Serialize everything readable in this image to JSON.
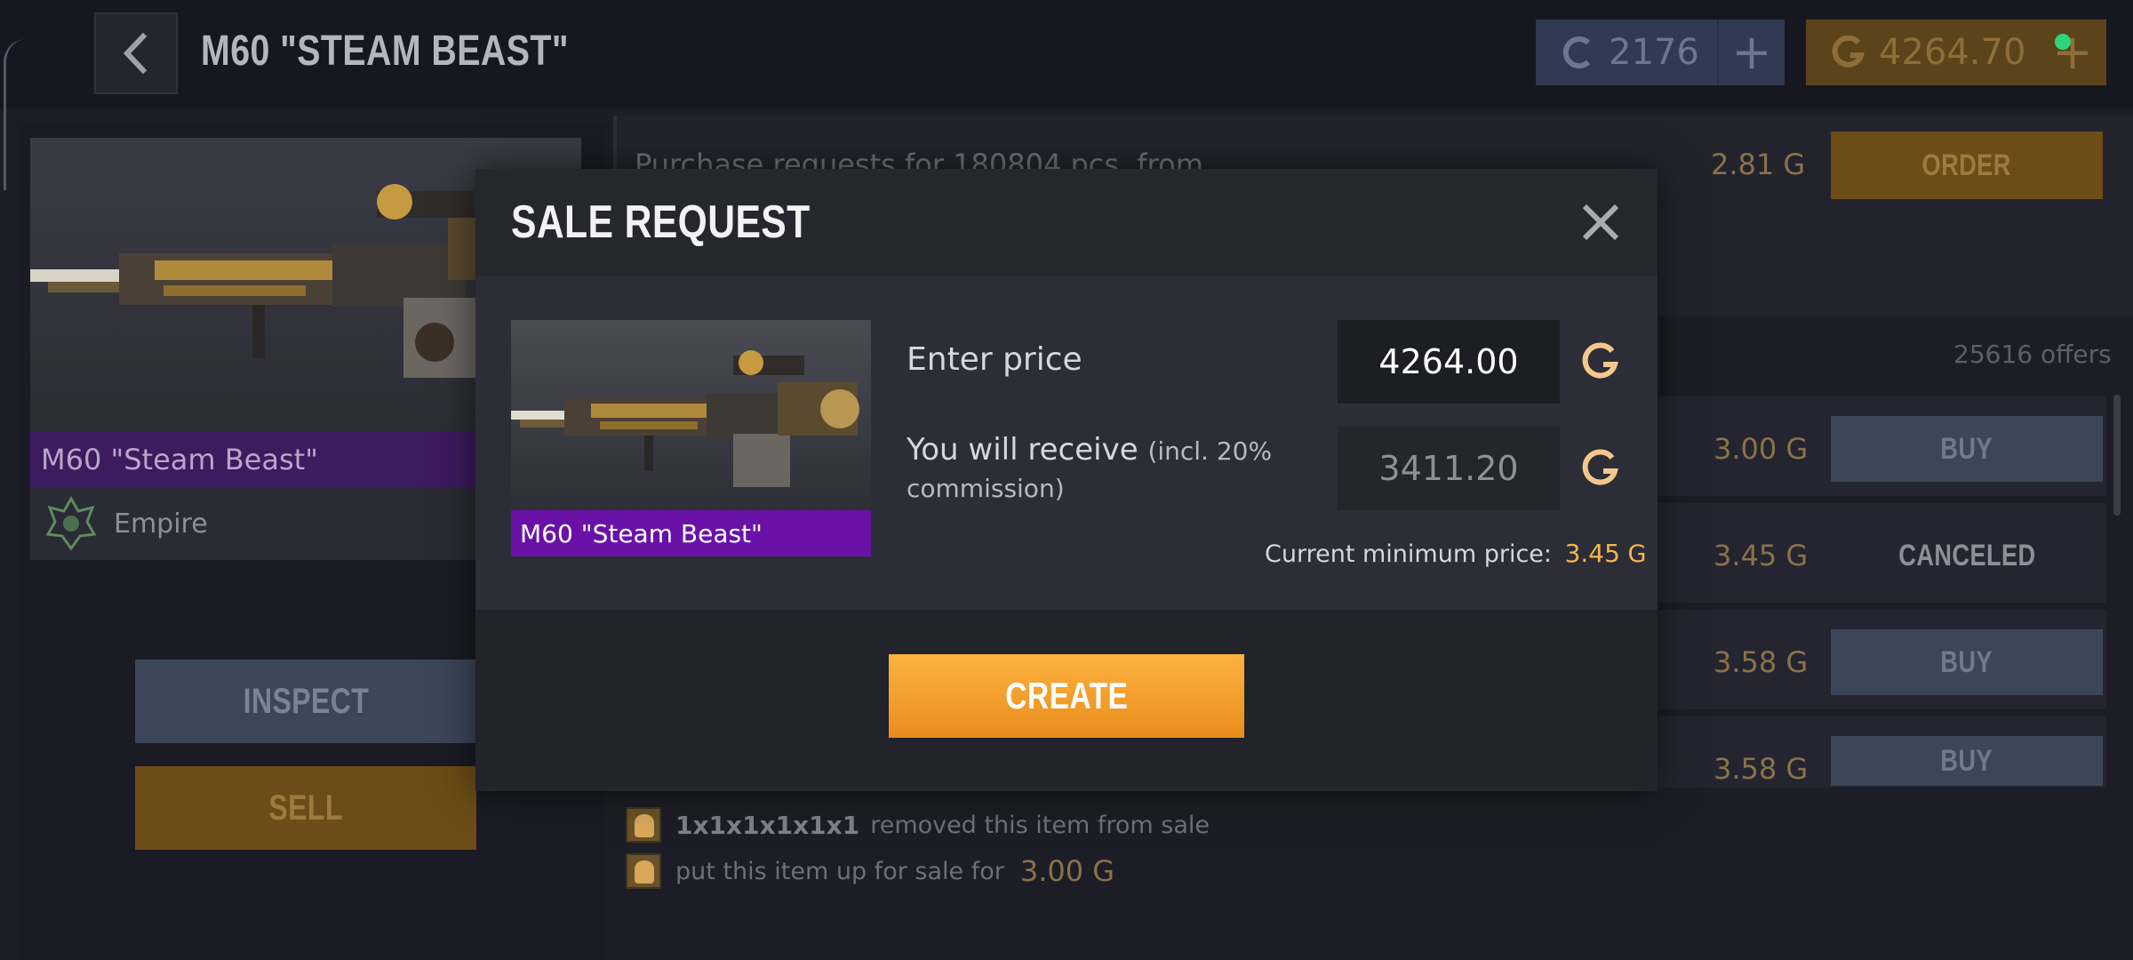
{
  "header": {
    "title": "M60 \"STEAM BEAST\"",
    "silver_balance": "2176",
    "gold_balance": "4264.70",
    "plus_symbol": "+"
  },
  "left": {
    "item_name": "M60 \"Steam Beast\"",
    "faction": "Empire",
    "inspect_label": "INSPECT",
    "sell_label": "SELL"
  },
  "market": {
    "purchase_text": "Purchase requests for 180804 pcs. from",
    "order_price": "2.81",
    "order_label": "ORDER",
    "offers_count": "25616 offers",
    "offers": [
      {
        "price": "3.00",
        "action": "BUY"
      },
      {
        "price": "3.45",
        "action": "CANCELED"
      },
      {
        "price": "3.58",
        "action": "BUY"
      },
      {
        "price": "3.58",
        "action": "BUY"
      }
    ],
    "activity": [
      {
        "user": "1x1x1x1x1x1",
        "text": "removed this item from sale",
        "amount": ""
      },
      {
        "user": "",
        "text": "put this item up for sale for",
        "amount": "3.00"
      }
    ]
  },
  "modal": {
    "title": "SALE REQUEST",
    "item_name": "M60 \"Steam Beast\"",
    "enter_price_label": "Enter price",
    "price_value": "4264.00",
    "receive_label": "You will receive",
    "commission_note": "(incl. 20% commission)",
    "receive_value": "3411.20",
    "min_price_label": "Current minimum price:",
    "min_price_value": "3.45",
    "create_label": "CREATE"
  },
  "colors": {
    "rarity_purple": "#6a12a8",
    "create_orange": "#f5a22d",
    "gold_text": "#f4b54e",
    "buy_blue": "#3c4659",
    "order_brown": "#6c4c17"
  },
  "icons": {
    "back": "chevron-left-icon",
    "close": "close-icon",
    "silver_currency": "silver-coin-icon",
    "gold_currency": "gold-coin-icon",
    "faction": "empire-emblem-icon"
  }
}
